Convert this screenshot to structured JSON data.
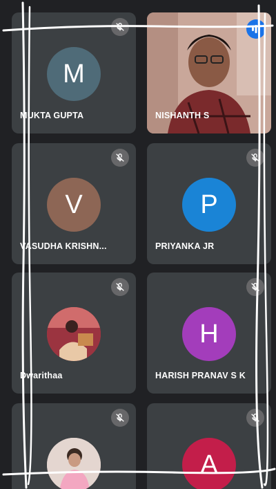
{
  "participants": [
    {
      "name": "MUKTA GUPTA",
      "initial": "M",
      "avatar_color": "#4f6b78",
      "muted": true,
      "type": "initial"
    },
    {
      "name": "NISHANTH S",
      "initial": "",
      "avatar_color": "",
      "muted": false,
      "type": "video"
    },
    {
      "name": "VASUDHA  KRISHN...",
      "initial": "V",
      "avatar_color": "#8d6655",
      "muted": true,
      "type": "initial"
    },
    {
      "name": "PRIYANKA JR",
      "initial": "P",
      "avatar_color": "#1a84d6",
      "muted": true,
      "type": "initial"
    },
    {
      "name": "Dwarithaa",
      "initial": "",
      "avatar_color": "#b9474e",
      "muted": true,
      "type": "photo"
    },
    {
      "name": "HARISH PRANAV S K",
      "initial": "H",
      "avatar_color": "#a33dbb",
      "muted": true,
      "type": "initial"
    },
    {
      "name": "",
      "initial": "",
      "avatar_color": "#d9c7c2",
      "muted": true,
      "type": "photo"
    },
    {
      "name": "",
      "initial": "A",
      "avatar_color": "#c31e4a",
      "muted": true,
      "type": "initial"
    }
  ],
  "icons": {
    "mute": "mic-off-icon",
    "speaking": "audio-wave-icon"
  }
}
